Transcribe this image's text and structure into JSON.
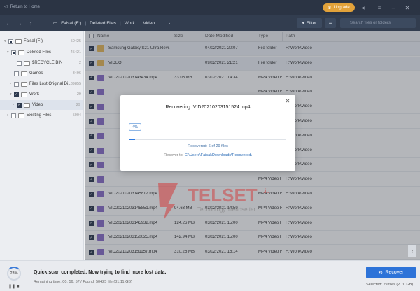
{
  "titlebar": {
    "back_label": "Return to Home",
    "upgrade_label": "Upgrade"
  },
  "navbar": {
    "breadcrumbs": [
      "Faisal (F:)",
      "Deleted Files",
      "Work",
      "Video"
    ],
    "filter_label": "Filter",
    "search_placeholder": "Search files or folders"
  },
  "sidebar": {
    "items": [
      {
        "label": "Faisal (F:)",
        "count": "50425"
      },
      {
        "label": "Deleted Files",
        "count": "45421"
      },
      {
        "label": "$RECYCLE.BIN",
        "count": "2"
      },
      {
        "label": "Games",
        "count": "3496"
      },
      {
        "label": "Files Lost Original Di...",
        "count": "39855"
      },
      {
        "label": "Work",
        "count": "29"
      },
      {
        "label": "Video",
        "count": "29"
      },
      {
        "label": "Existing Files",
        "count": "5004"
      }
    ]
  },
  "table": {
    "headers": {
      "name": "Name",
      "size": "Size",
      "date": "Date Modified",
      "type": "Type",
      "path": "Path"
    },
    "rows": [
      {
        "name": "Samsung Galaxy S21 Ultra Revi...",
        "size": "",
        "date": "04/02/2021 20:07",
        "type": "File folder",
        "path": "F:\\Work\\Video",
        "kind": "folder"
      },
      {
        "name": "VIDEO",
        "size": "",
        "date": "09/02/2021 21:21",
        "type": "File folder",
        "path": "F:\\Work\\Video",
        "kind": "folder"
      },
      {
        "name": "VID20210203143434.mp4",
        "size": "33.06 MB",
        "date": "03/02/2021 14:34",
        "type": "MP4 Video File",
        "path": "F:\\Work\\Video",
        "kind": "video"
      },
      {
        "name": "",
        "size": "",
        "date": "",
        "type": "MP4 Video File",
        "path": "F:\\Work\\Video",
        "kind": "video"
      },
      {
        "name": "",
        "size": "",
        "date": "",
        "type": "MP4 Video File",
        "path": "F:\\Work\\Video",
        "kind": "video"
      },
      {
        "name": "",
        "size": "",
        "date": "",
        "type": "MP4 Video File",
        "path": "F:\\Work\\Video",
        "kind": "video"
      },
      {
        "name": "",
        "size": "",
        "date": "",
        "type": "MP4 Video File",
        "path": "F:\\Work\\Video",
        "kind": "video"
      },
      {
        "name": "",
        "size": "",
        "date": "",
        "type": "MP4 Video File",
        "path": "F:\\Work\\Video",
        "kind": "video"
      },
      {
        "name": "",
        "size": "",
        "date": "03/02/2021 14:57",
        "type": "MP4 Video File",
        "path": "F:\\Work\\Video",
        "kind": "video"
      },
      {
        "name": "",
        "size": "",
        "date": "",
        "type": "MP4 Video File",
        "path": "F:\\Work\\Video",
        "kind": "video"
      },
      {
        "name": "VID20210203145812.mp4",
        "size": "",
        "date": "",
        "type": "MP4 Video File",
        "path": "F:\\Work\\Video",
        "kind": "video"
      },
      {
        "name": "VID20210203145851.mp4",
        "size": "94.63 MB",
        "date": "03/02/2021 14:59",
        "type": "MP4 Video File",
        "path": "F:\\Work\\Video",
        "kind": "video"
      },
      {
        "name": "VID20210203145932.mp4",
        "size": "124.26 MB",
        "date": "03/02/2021 15:00",
        "type": "MP4 Video File",
        "path": "F:\\Work\\Video",
        "kind": "video"
      },
      {
        "name": "VID20210203150025.mp4",
        "size": "142.94 MB",
        "date": "03/02/2021 15:00",
        "type": "MP4 Video File",
        "path": "F:\\Work\\Video",
        "kind": "video"
      },
      {
        "name": "VID20210203151157.mp4",
        "size": "310.26 MB",
        "date": "03/02/2021 15:14",
        "type": "MP4 Video File",
        "path": "F:\\Work\\Video",
        "kind": "video"
      }
    ]
  },
  "modal": {
    "title": "Recovering: VID20210203151524.mp4",
    "percent_label": "4%",
    "progress": 0.04,
    "recovered_text": "Recovered: 6 of 29 files",
    "recover_to_label": "Recover to:",
    "recover_to_path": "C:\\Users\\Faisal\\Downloads\\Recovered\\"
  },
  "watermark": {
    "brand": "TELSET",
    "tag": ".id",
    "tagline": "Technology Trendsetter"
  },
  "footer": {
    "scan_percent": "23%",
    "scan_progress": 0.23,
    "status_main": "Quick scan completed. Now trying to find more lost data.",
    "status_sub": "Remaining time: 00: 56: 57 / Found: 50425 file (81.11 GB)",
    "recover_label": "Recover",
    "selected_info": "Selected: 29 files (2.70 GB)"
  },
  "colors": {
    "titlebar": "#2b3444",
    "navbar": "#323d4f",
    "upgrade": "#e2a23a",
    "accent": "#2d73d8",
    "watermark": "#d23a3a"
  }
}
